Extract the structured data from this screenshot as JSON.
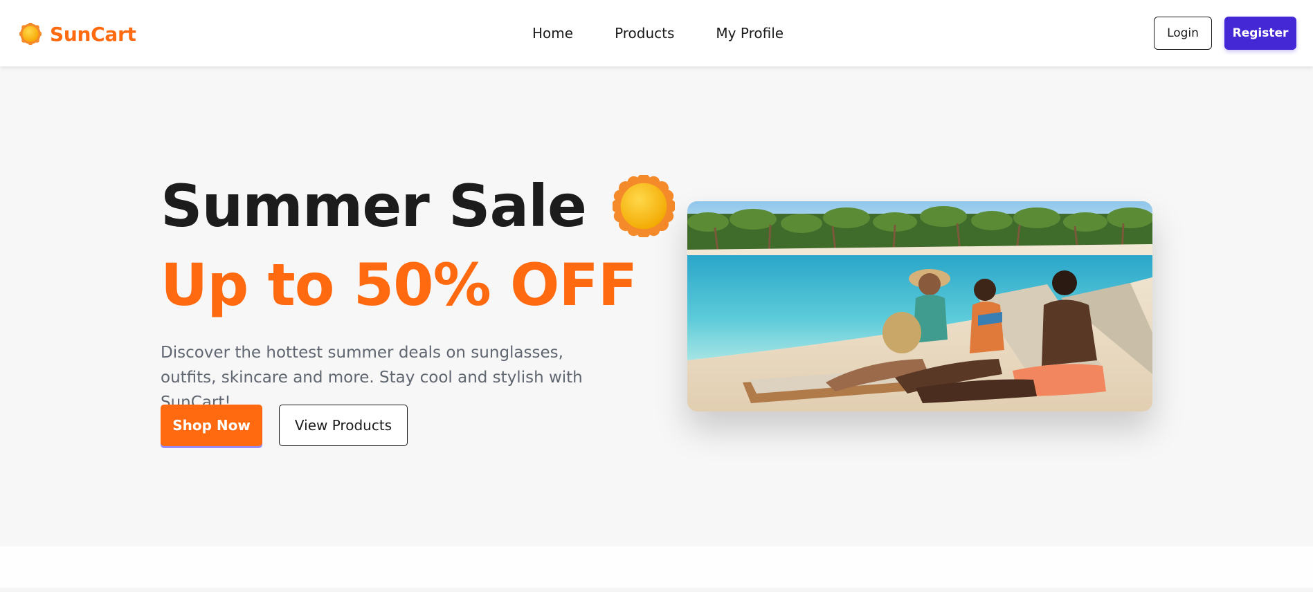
{
  "header": {
    "brand_name": "SunCart",
    "brand_icon": "sun-icon",
    "nav": [
      {
        "label": "Home"
      },
      {
        "label": "Products"
      },
      {
        "label": "My Profile"
      }
    ],
    "login_label": "Login",
    "register_label": "Register"
  },
  "hero": {
    "title": "Summer Sale",
    "title_icon": "sun-icon",
    "subtitle": "Up to 50% OFF",
    "description": "Discover the hottest summer deals on sunglasses, outfits, skincare and more. Stay cool and stylish with SunCart!",
    "primary_cta": "Shop Now",
    "secondary_cta": "View Products",
    "image_subject": "beach-photo"
  },
  "colors": {
    "accent": "#ff6a10",
    "register": "#4428d6",
    "hero_bg": "#f7f7f7",
    "title": "#1c1c1c",
    "muted_text": "#5f6670"
  }
}
